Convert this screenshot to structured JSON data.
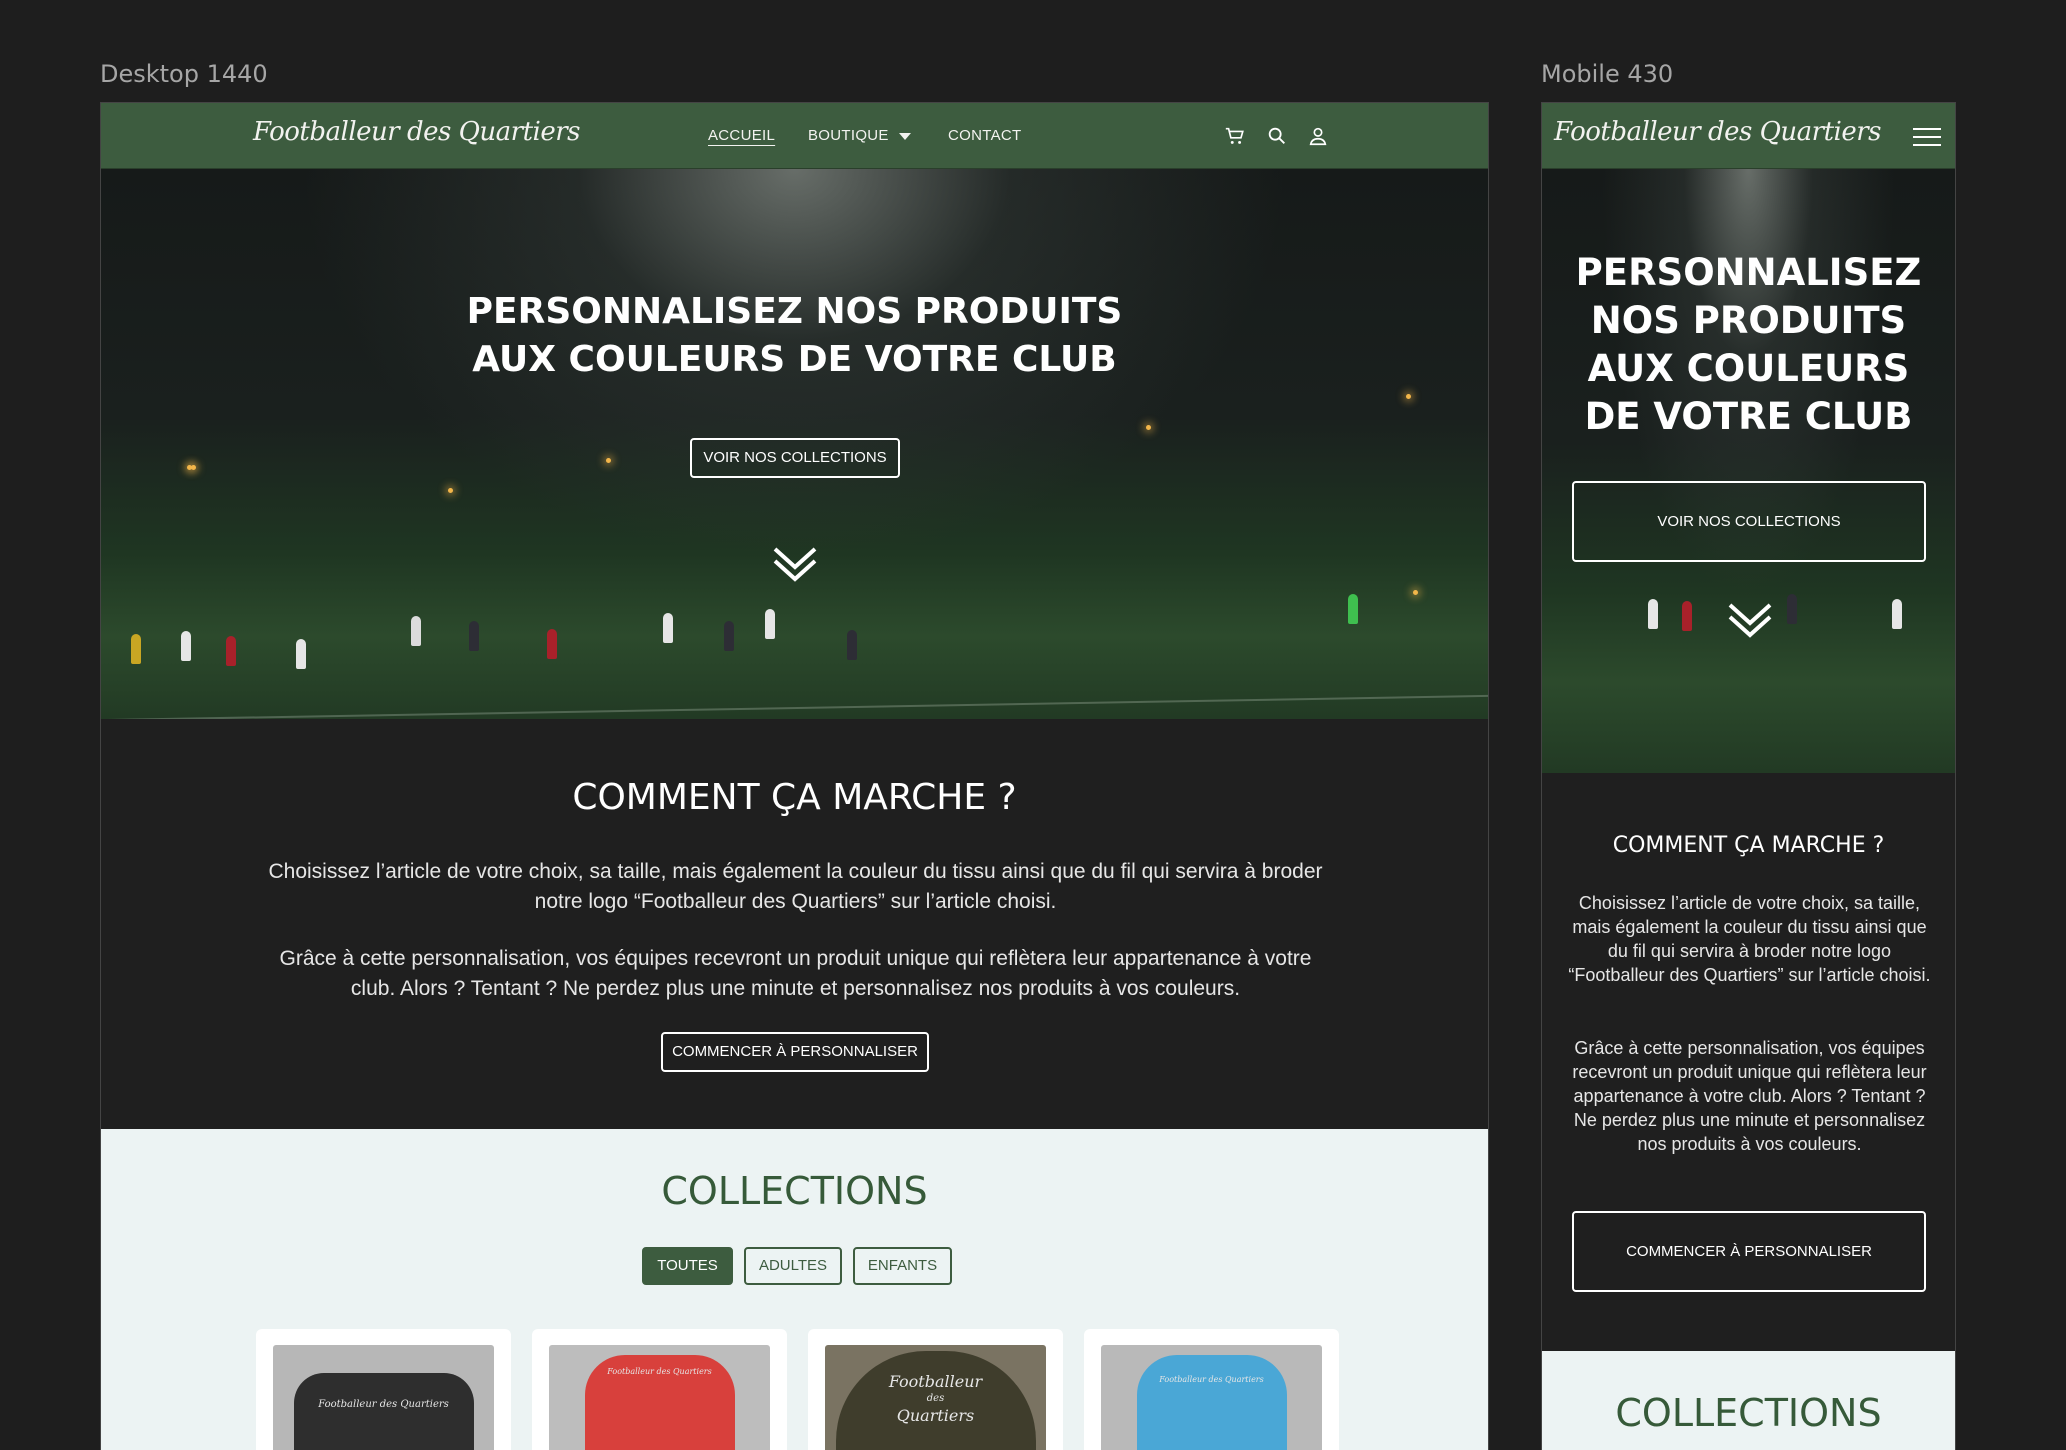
{
  "labels": {
    "desktop": "Desktop 1440",
    "mobile": "Mobile 430"
  },
  "brand": "Footballeur des Quartiers",
  "nav": {
    "home": "ACCUEIL",
    "shop": "BOUTIQUE",
    "contact": "CONTACT"
  },
  "hero": {
    "title_line1": "PERSONNALISEZ NOS PRODUITS",
    "title_line2": "AUX COULEURS DE VOTRE CLUB",
    "mobile_lines": [
      "PERSONNALISEZ",
      "NOS PRODUITS",
      "AUX COULEURS",
      "DE VOTRE CLUB"
    ],
    "cta": "VOIR NOS COLLECTIONS"
  },
  "how": {
    "title": "COMMENT ÇA MARCHE ?",
    "p1": "Choisissez l’article de votre choix, sa taille, mais également la couleur du tissu ainsi que du fil qui servira à broder notre logo “Footballeur des Quartiers” sur l’article choisi.",
    "p2": "Grâce à cette personnalisation, vos équipes recevront un produit unique qui reflètera leur appartenance à votre club. Alors ? Tentant ? Ne perdez plus une minute et personnalisez nos produits à vos couleurs.",
    "cta": "COMMENCER À PERSONNALISER"
  },
  "collections": {
    "title": "COLLECTIONS",
    "filters": [
      "TOUTES",
      "ADULTES",
      "ENFANTS"
    ],
    "active_filter": "TOUTES",
    "products": [
      {
        "type": "t-shirt",
        "color": "#2e2e2e",
        "logo": "Footballeur des Quartiers"
      },
      {
        "type": "hoodie",
        "color": "#d8403c",
        "logo": "Footballeur des Quartiers"
      },
      {
        "type": "cap",
        "color": "#3f3d2c",
        "logo_lines": [
          "Footballeur",
          "des",
          "Quartiers"
        ]
      },
      {
        "type": "hoodie",
        "color": "#4aa7d6",
        "logo": "Footballeur des Quartiers"
      }
    ]
  },
  "colors": {
    "header_green": "#3d5c3f",
    "dark_bg": "#1f1f1f",
    "collections_bg": "#ecf3f3",
    "accent_green": "#365a39"
  }
}
